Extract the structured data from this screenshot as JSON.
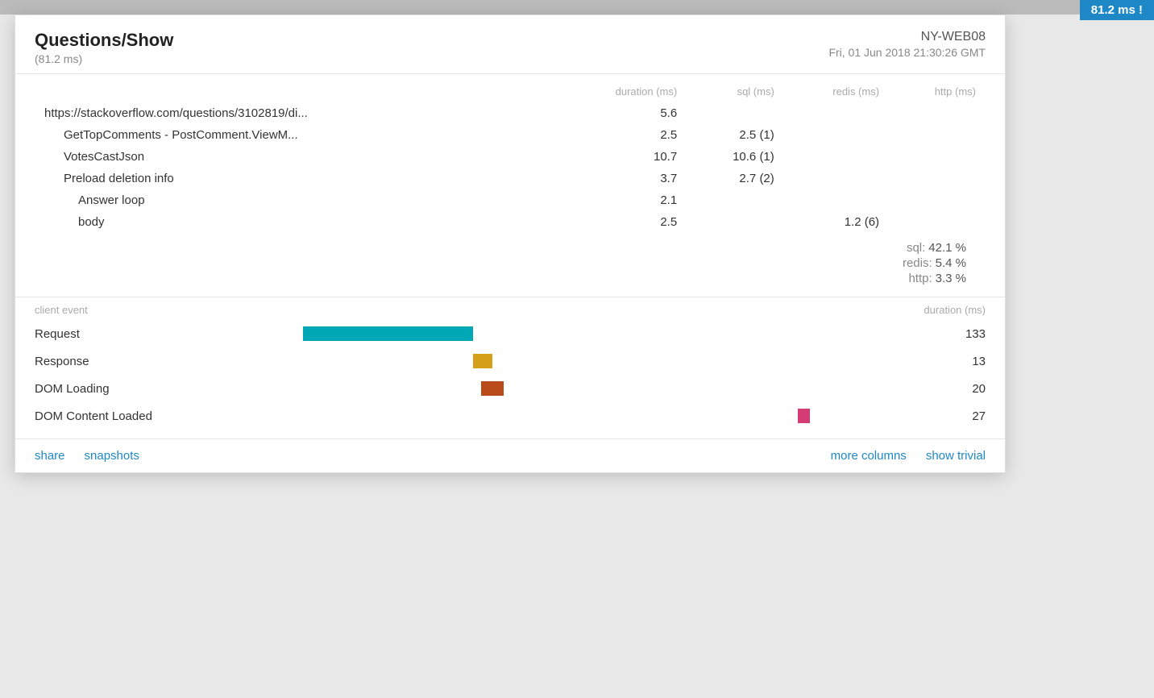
{
  "badge": {
    "label": "81.2 ms !"
  },
  "popup": {
    "title": "Questions/Show",
    "subtitle": "(81.2 ms)",
    "server": "NY-WEB08",
    "timestamp": "Fri, 01 Jun 2018 21:30:26 GMT",
    "columns": {
      "duration": "duration (ms)",
      "sql": "sql (ms)",
      "redis": "redis (ms)",
      "http": "http (ms)"
    },
    "rows": [
      {
        "label": "https://stackoverflow.com/questions/3102819/di...",
        "indent": 0,
        "duration": "5.6",
        "sql": "",
        "redis": "",
        "http": ""
      },
      {
        "label": "GetTopComments - PostComment.ViewM...",
        "indent": 1,
        "duration": "2.5",
        "sql": "2.5 (1)",
        "redis": "",
        "http": ""
      },
      {
        "label": "VotesCastJson",
        "indent": 1,
        "duration": "10.7",
        "sql": "10.6 (1)",
        "redis": "",
        "http": ""
      },
      {
        "label": "Preload deletion info",
        "indent": 1,
        "duration": "3.7",
        "sql": "2.7 (2)",
        "redis": "",
        "http": ""
      },
      {
        "label": "Answer loop",
        "indent": 2,
        "duration": "2.1",
        "sql": "",
        "redis": "",
        "http": ""
      },
      {
        "label": "body",
        "indent": 2,
        "duration": "2.5",
        "sql": "",
        "redis": "1.2 (6)",
        "http": ""
      }
    ],
    "stats": [
      {
        "label": "sql:",
        "value": "42.1 %"
      },
      {
        "label": "redis:",
        "value": "5.4 %"
      },
      {
        "label": "http:",
        "value": "3.3 %"
      }
    ],
    "client_section": {
      "header_event": "client event",
      "header_duration": "duration (ms)",
      "events": [
        {
          "label": "Request",
          "duration": "133",
          "bar_color": "#00a8b5",
          "bar_left_pct": 18,
          "bar_width_pct": 22
        },
        {
          "label": "Response",
          "duration": "13",
          "bar_color": "#d4a017",
          "bar_left_pct": 40,
          "bar_width_pct": 2.5
        },
        {
          "label": "DOM Loading",
          "duration": "20",
          "bar_color": "#b94a1a",
          "bar_left_pct": 41,
          "bar_width_pct": 3
        },
        {
          "label": "DOM Content Loaded",
          "duration": "27",
          "bar_color": "#d63b75",
          "bar_left_pct": 82,
          "bar_width_pct": 1.5
        }
      ]
    },
    "footer": {
      "links_left": [
        {
          "label": "share",
          "id": "share"
        },
        {
          "label": "snapshots",
          "id": "snapshots"
        }
      ],
      "links_right": [
        {
          "label": "more columns",
          "id": "more-columns"
        },
        {
          "label": "show trivial",
          "id": "show-trivial"
        }
      ]
    }
  }
}
